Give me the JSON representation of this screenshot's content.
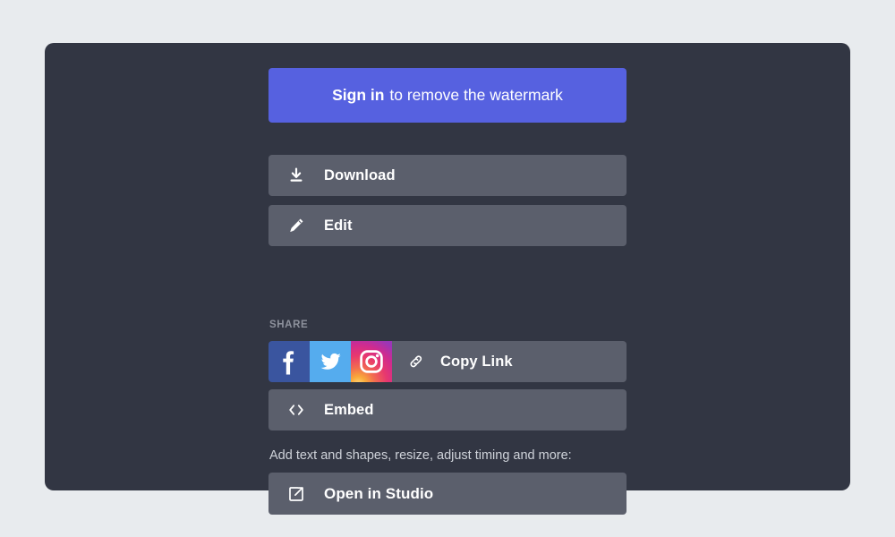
{
  "theme": {
    "page_background": "#e8ebee",
    "panel_background": "#323643",
    "button_background": "#5b5f6c",
    "accent": "#5661e0",
    "facebook_color": "#3a559f",
    "twitter_color": "#55acee",
    "instagram_gradient_from": "#ffd776",
    "instagram_gradient_to": "#9b36b7",
    "label_color": "#8d919c",
    "hint_color": "#cfd3da",
    "text_color": "#ffffff"
  },
  "signin": {
    "strong_text": "Sign in",
    "rest_text": "to remove the watermark"
  },
  "actions": {
    "download_label": "Download",
    "download_icon": "download-icon",
    "edit_label": "Edit",
    "edit_icon": "pencil-icon"
  },
  "share": {
    "section_label": "SHARE",
    "facebook_icon": "facebook-icon",
    "twitter_icon": "twitter-icon",
    "instagram_icon": "instagram-icon",
    "copy_link_label": "Copy Link",
    "copy_link_icon": "link-icon",
    "embed_label": "Embed",
    "embed_icon": "code-brackets-icon"
  },
  "studio": {
    "hint_text": "Add text and shapes, resize, adjust timing and more:",
    "button_label": "Open in Studio",
    "button_icon": "external-link-icon"
  }
}
